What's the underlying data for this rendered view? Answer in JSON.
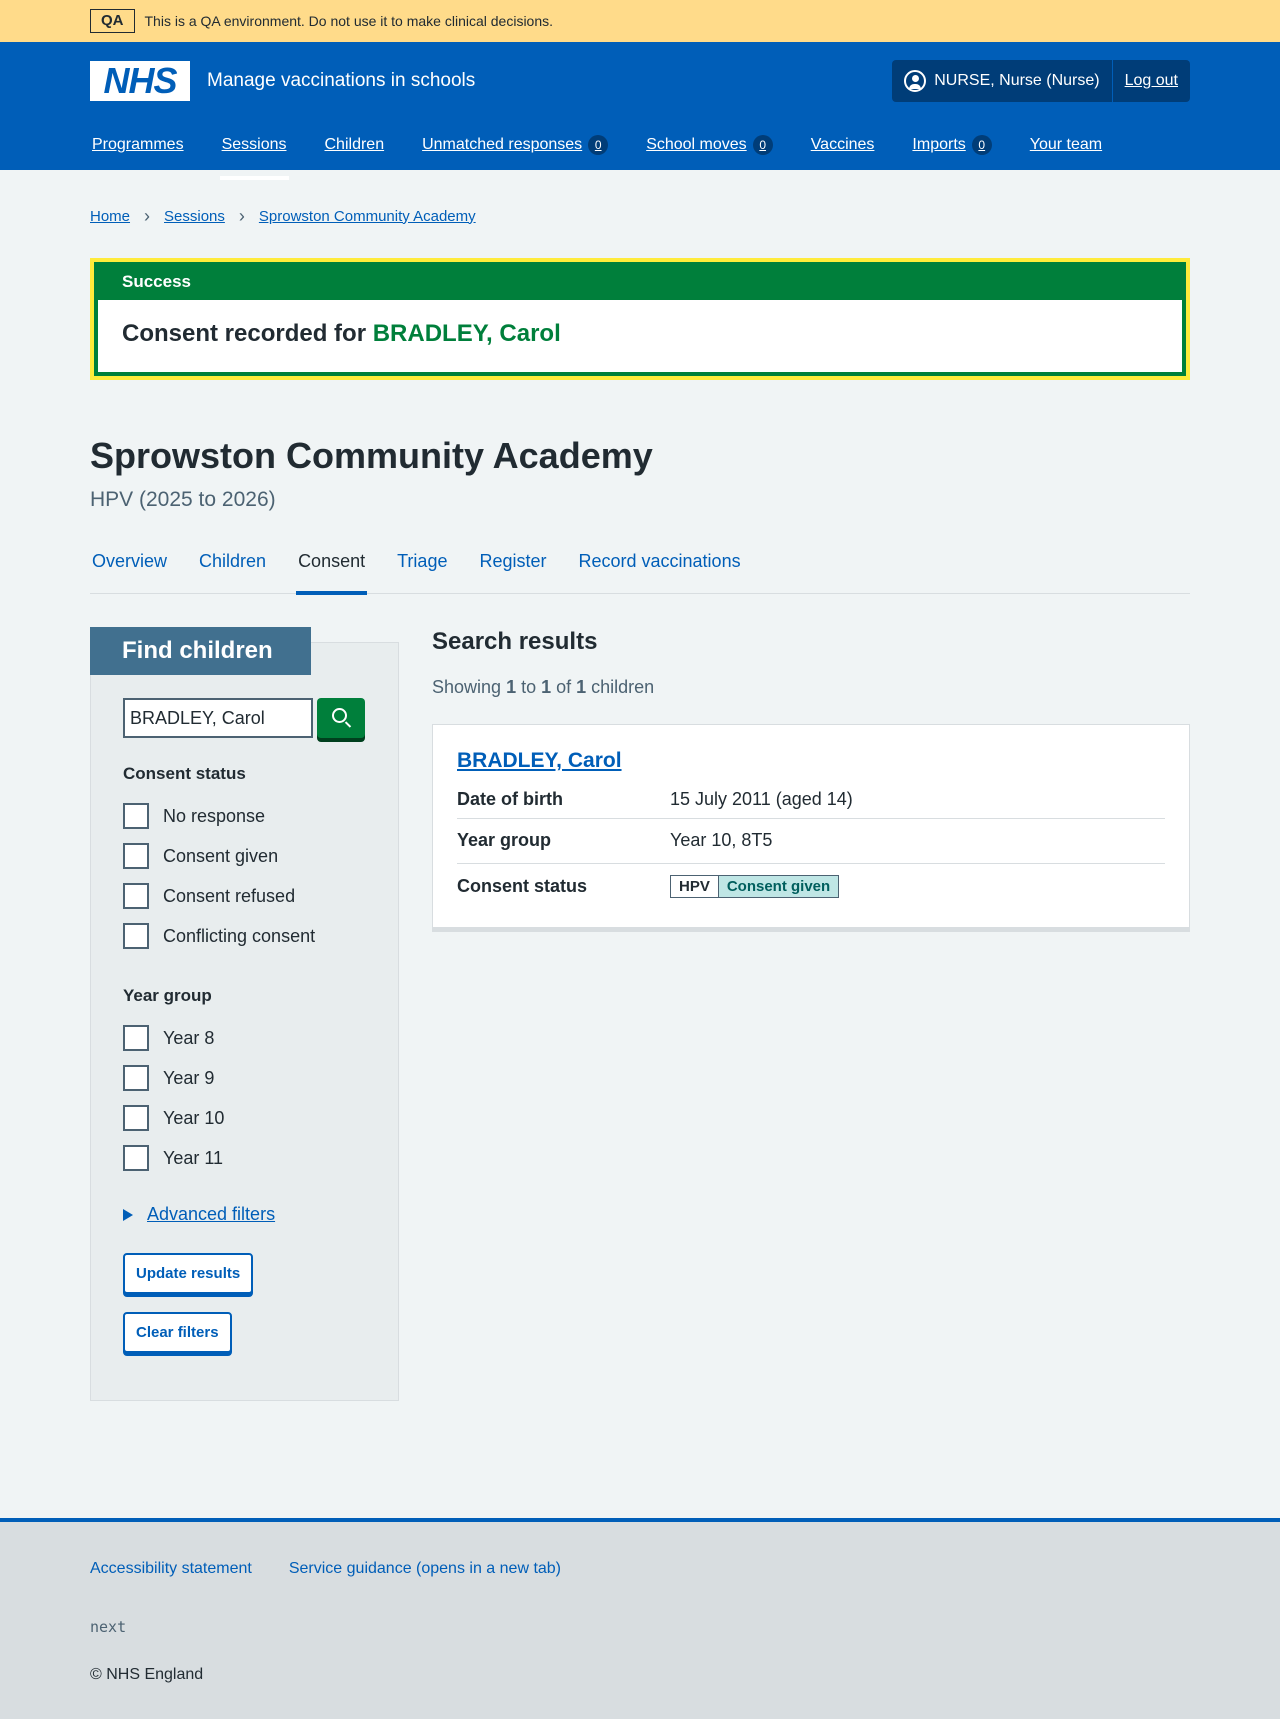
{
  "qa_banner": {
    "tag": "QA",
    "text": "This is a QA environment. Do not use it to make clinical decisions."
  },
  "header": {
    "logo": "NHS",
    "service_name": "Manage vaccinations in schools",
    "user": "NURSE, Nurse (Nurse)",
    "logout": "Log out",
    "nav": [
      {
        "label": "Programmes"
      },
      {
        "label": "Sessions",
        "active": true
      },
      {
        "label": "Children"
      },
      {
        "label": "Unmatched responses",
        "count": "0"
      },
      {
        "label": "School moves",
        "count": "0"
      },
      {
        "label": "Vaccines"
      },
      {
        "label": "Imports",
        "count": "0"
      },
      {
        "label": "Your team"
      }
    ]
  },
  "breadcrumb": [
    "Home",
    "Sessions",
    "Sprowston Community Academy"
  ],
  "success": {
    "heading": "Success",
    "message": "Consent recorded for ",
    "link": "BRADLEY, Carol"
  },
  "page": {
    "title": "Sprowston Community Academy",
    "caption": "HPV (2025 to 2026)",
    "tabs": [
      "Overview",
      "Children",
      "Consent",
      "Triage",
      "Register",
      "Record vaccinations"
    ],
    "active_tab": "Consent"
  },
  "filters": {
    "heading": "Find children",
    "search_value": "BRADLEY, Carol",
    "consent_legend": "Consent status",
    "consent_options": [
      "No response",
      "Consent given",
      "Consent refused",
      "Conflicting consent"
    ],
    "year_legend": "Year group",
    "year_options": [
      "Year 8",
      "Year 9",
      "Year 10",
      "Year 11"
    ],
    "advanced": "Advanced filters",
    "update_button": "Update results",
    "clear_button": "Clear filters"
  },
  "results": {
    "title": "Search results",
    "showing_prefix": "Showing ",
    "from": "1",
    "to_word": " to ",
    "to": "1",
    "of_word": " of ",
    "total": "1",
    "suffix": " children",
    "items": [
      {
        "name": "BRADLEY, Carol",
        "dob_label": "Date of birth",
        "dob": "15 July 2011 (aged 14)",
        "year_label": "Year group",
        "year": "Year 10, 8T5",
        "consent_label": "Consent status",
        "programme": "HPV",
        "consent": "Consent given"
      }
    ]
  },
  "footer": {
    "links": [
      "Accessibility statement",
      "Service guidance (opens in a new tab)"
    ],
    "version": "next",
    "copyright": "© NHS England"
  },
  "colors": {
    "nhs_blue": "#005eb8",
    "success_green": "#007f3b",
    "qa_yellow": "#ffdb8a",
    "focus_yellow": "#ffeb3b"
  }
}
